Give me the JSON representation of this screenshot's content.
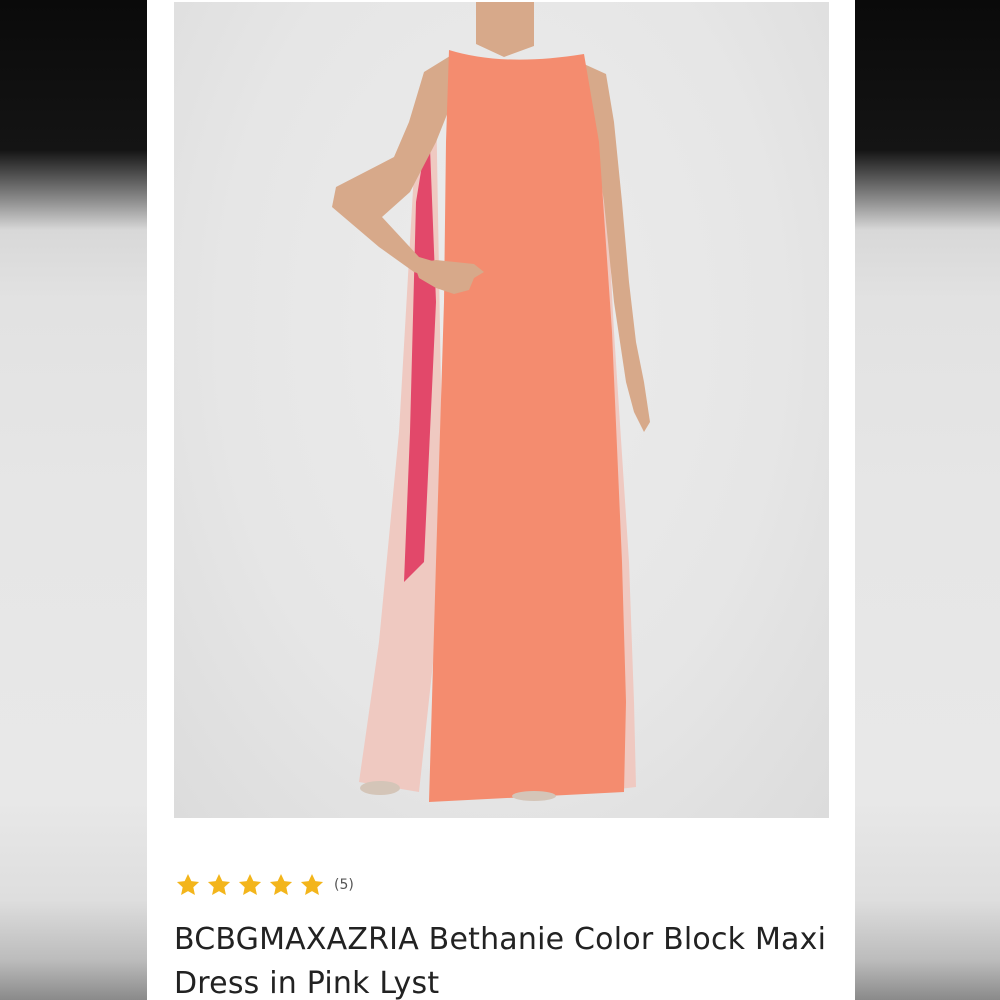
{
  "product": {
    "title": "BCBGMAXAZRIA Bethanie Color Block Maxi Dress in Pink Lyst",
    "image_alt": "Model wearing a coral and blush color block sleeveless maxi dress",
    "rating": {
      "stars": 5,
      "max_stars": 5,
      "count_label": "(5)"
    }
  },
  "colors": {
    "star": "#f3b51b",
    "dress_coral": "#f48c6f",
    "dress_blush": "#efc9c1",
    "dress_pink_accent": "#e2486a",
    "title_text": "#222222"
  },
  "icons": {
    "star": "star-icon"
  }
}
